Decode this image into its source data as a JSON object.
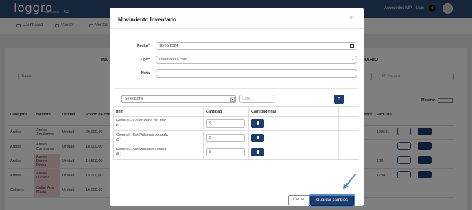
{
  "app": {
    "logo_text": "loggro",
    "logo_sub": "POS Tienda",
    "accessories_label": "Accesorios MP",
    "user_label": "Luis",
    "notif_count": "0"
  },
  "menu": [
    {
      "label": "Dashboard"
    },
    {
      "label": "Vender"
    },
    {
      "label": "Ventas"
    }
  ],
  "background": {
    "heading_left": "INV",
    "heading_right": "TARIO",
    "filter_select": "Todos",
    "factura_placeholder": "Nº Factura",
    "mostrar_label": "Mostrar",
    "table_headers": [
      "Categoría",
      "Nombre",
      "Unidad",
      "Precio de compra",
      "Proveedor",
      "Fact. No."
    ],
    "rows": [
      {
        "cat": "Aretes",
        "name": "Aretes Amalanna",
        "unit": "Unidad",
        "price": "20.000,00",
        "fact": "123541"
      },
      {
        "cat": "Aretes",
        "name": "Aretes Cartagena",
        "unit": "Unidad",
        "price": "18.000,00",
        "fact": ""
      },
      {
        "cat": "Aretes",
        "name": "Aretes Donna Dinna",
        "unit": "Unidad",
        "price": "14.500,00",
        "fact": "123"
      },
      {
        "cat": "Aretes",
        "name": "Aretes Luciana",
        "unit": "Unidad",
        "price": "15.000,00",
        "fact": "1234"
      },
      {
        "cat": "Collares",
        "name": "Collar Ana María",
        "unit": "Unidad",
        "price": "16.000,00",
        "fact": ""
      }
    ]
  },
  "modal": {
    "title": "Movimiento Inventario",
    "close": "×",
    "fecha_label": "Fecha*",
    "fecha_value": "18/03/2024",
    "tipo_label": "Tipo*",
    "tipo_value": "Inventario a cero",
    "nota_label": "Nota",
    "nota_value": "",
    "product_select": "Seleccione",
    "cant_placeholder": "Cant.",
    "add_label": "+",
    "col_item": "Item",
    "col_cantidad": "Cantidad",
    "col_final": "Cantidad final",
    "items": [
      {
        "line1": "General - Collar Perla del mar",
        "line2": "(9 )",
        "qty": "9"
      },
      {
        "line1": "General - Set Pulseras Ananda",
        "line2": "(5 )",
        "qty": "5"
      },
      {
        "line1": "General - Set Pulseras Donna",
        "line2": "(8 )",
        "qty": "8"
      }
    ],
    "btn_cerrar": "Cerrar",
    "btn_guardar": "Guardar cambios"
  },
  "colors": {
    "primary": "#1c3d6e",
    "topbar": "#2d4a74",
    "annotation_arrow": "#4f86c6"
  }
}
